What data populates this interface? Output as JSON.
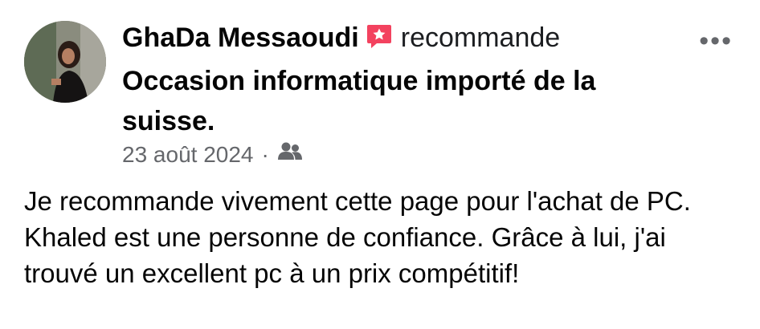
{
  "post": {
    "author": "GhaDa Messaoudi",
    "verb": "recommande",
    "page_name": "Occasion informatique importé de la suisse.",
    "date": "23 août 2024",
    "separator": "·",
    "audience_icon": "friends-icon",
    "more_icon": "more-options-icon",
    "more_label": "•••",
    "badge_icon": "recommend-star-icon",
    "badge_color": "#f3425f",
    "text": "Je recommande vivement cette page pour l'achat de PC. Khaled est une personne de confiance. Grâce à lui, j'ai trouvé un excellent pc à un prix compétitif!"
  }
}
